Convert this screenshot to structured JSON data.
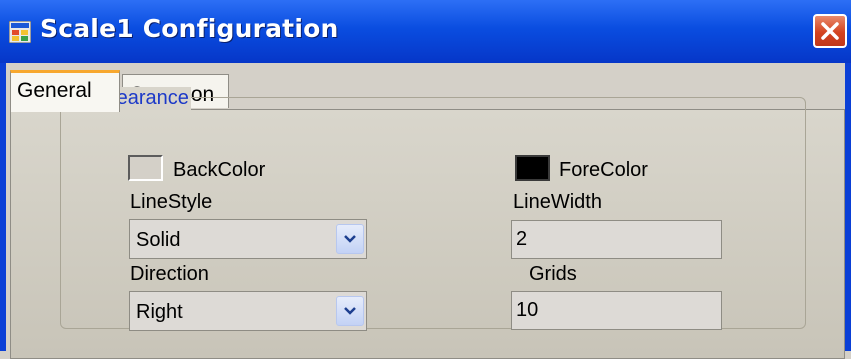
{
  "window": {
    "title": "Scale1 Configuration",
    "icon": "app-window-icon",
    "close_icon": "close-icon"
  },
  "tabs": [
    {
      "label": "General",
      "active": true
    },
    {
      "label": "Common",
      "active": false
    }
  ],
  "appearance": {
    "title": "Appearance",
    "backcolor": {
      "label": "BackColor",
      "color": "#d4d0c8"
    },
    "forecolor": {
      "label": "ForeColor",
      "color": "#000000"
    },
    "linestyle": {
      "label": "LineStyle",
      "value": "Solid"
    },
    "linewidth": {
      "label": "LineWidth",
      "value": "2"
    },
    "direction": {
      "label": "Direction",
      "value": "Right"
    },
    "grids": {
      "label": "Grids",
      "value": "10"
    }
  },
  "colors": {
    "title_bar": "#0a4de0",
    "group_title": "#1c39c8",
    "active_tab_accent": "#f7a72e",
    "close_button": "#d4431f"
  }
}
